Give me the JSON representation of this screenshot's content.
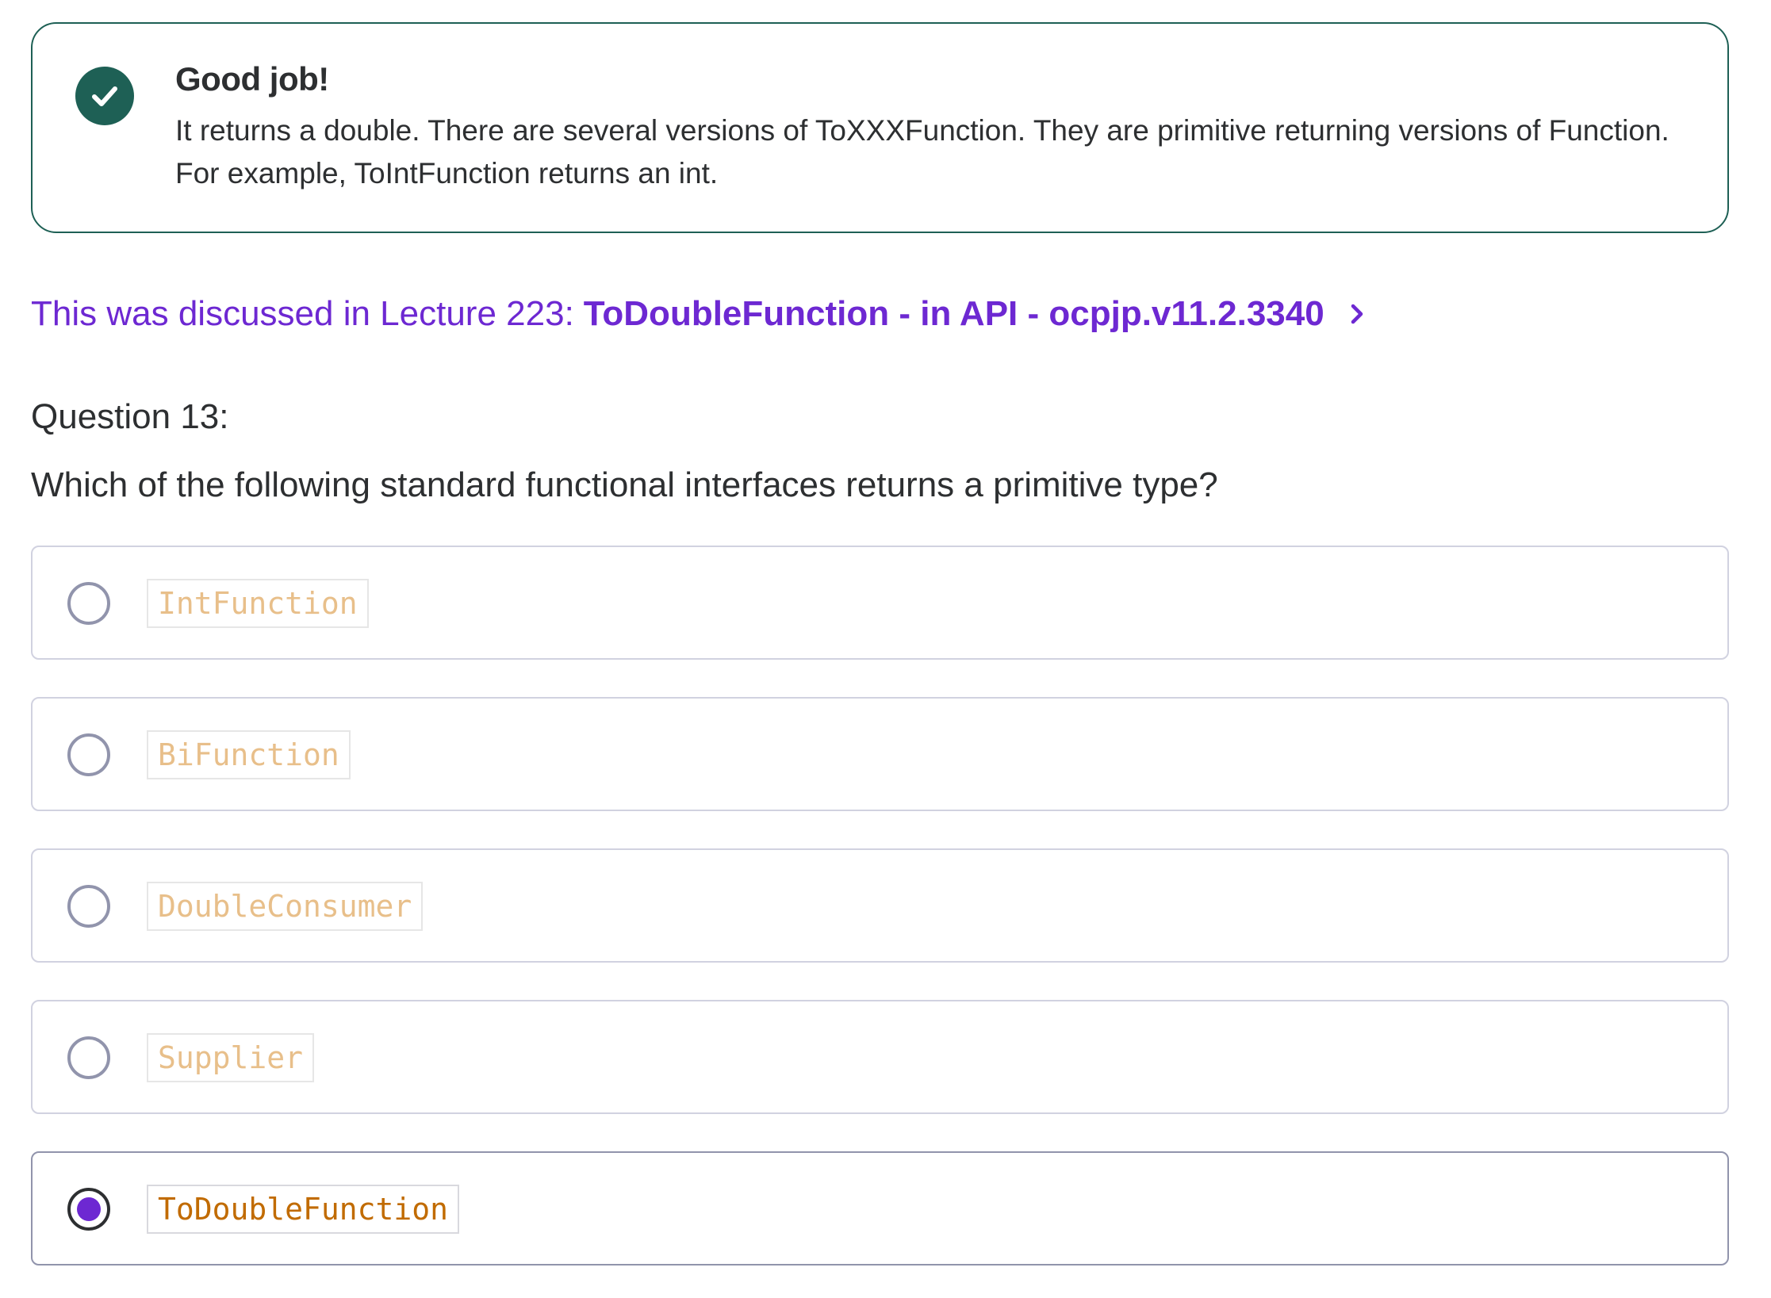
{
  "feedback": {
    "title": "Good job!",
    "body": "It returns a double. There are several versions of ToXXXFunction. They are primitive returning versions of Function. For example, ToIntFunction returns an int.",
    "icon": "check-circle-icon",
    "accent_color": "#1e6055"
  },
  "lecture_link": {
    "prefix": "This was discussed in Lecture 223:",
    "title": "ToDoubleFunction - in API - ocpjp.v11.2.3340",
    "icon": "chevron-right-icon",
    "color": "#6d28d2"
  },
  "question": {
    "number_label": "Question 13:",
    "text": "Which of the following standard functional interfaces returns a primitive type?"
  },
  "options": [
    {
      "label": "IntFunction",
      "selected": false
    },
    {
      "label": "BiFunction",
      "selected": false
    },
    {
      "label": "DoubleConsumer",
      "selected": false
    },
    {
      "label": "Supplier",
      "selected": false
    },
    {
      "label": "ToDoubleFunction",
      "selected": true
    }
  ],
  "colors": {
    "selected_radio": "#6d28d2",
    "code_text_selected": "#c16b00",
    "code_text_unselected": "#e8bf8a"
  }
}
